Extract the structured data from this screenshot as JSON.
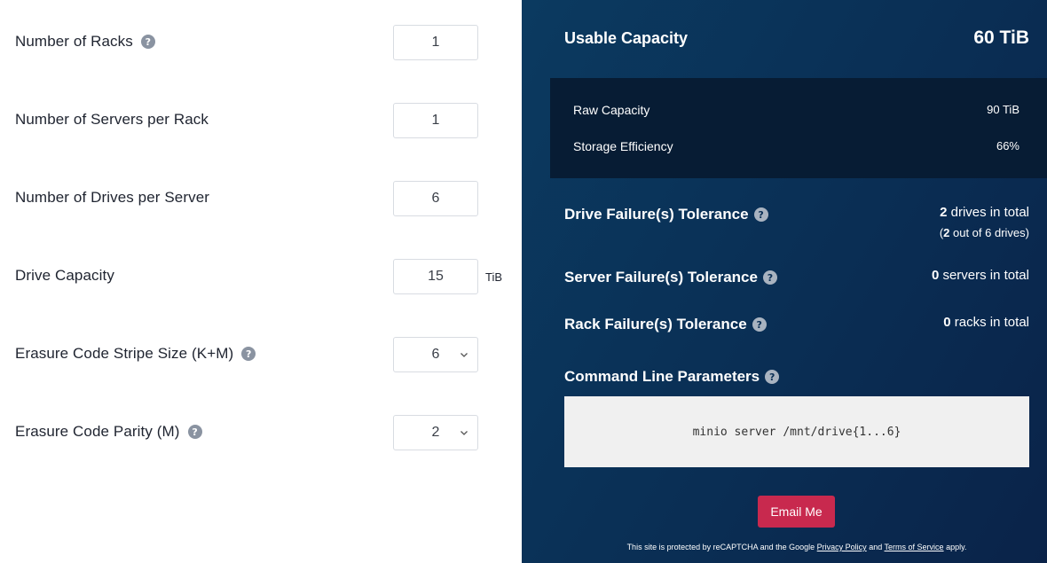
{
  "form": {
    "racks": {
      "label": "Number of Racks",
      "value": "1",
      "help_icon": "question-circle-icon"
    },
    "servers": {
      "label": "Number of Servers per Rack",
      "value": "1"
    },
    "drives": {
      "label": "Number of Drives per Server",
      "value": "6"
    },
    "capacity": {
      "label": "Drive Capacity",
      "value": "15",
      "unit": "TiB"
    },
    "stripe": {
      "label": "Erasure Code Stripe Size (K+M)",
      "value": "6",
      "help_icon": "question-circle-icon"
    },
    "parity": {
      "label": "Erasure Code Parity (M)",
      "value": "2",
      "help_icon": "question-circle-icon"
    }
  },
  "summary": {
    "usable_label": "Usable Capacity",
    "usable_value": "60 TiB",
    "raw_label": "Raw Capacity",
    "raw_value": "90 TiB",
    "efficiency_label": "Storage Efficiency",
    "efficiency_value": "66%",
    "drive_tol_label": "Drive Failure(s) Tolerance",
    "drive_tol_count": "2",
    "drive_tol_suffix": " drives in total",
    "drive_tol_sub_num": "2",
    "drive_tol_sub_rest": " out of 6 drives)",
    "drive_tol_sub_open": "(",
    "server_tol_label": "Server Failure(s) Tolerance",
    "server_tol_count": "0",
    "server_tol_suffix": " servers in total",
    "rack_tol_label": "Rack Failure(s) Tolerance",
    "rack_tol_count": "0",
    "rack_tol_suffix": " racks in total",
    "cmd_label": "Command Line Parameters",
    "cmd_value": "minio server /mnt/drive{1...6}",
    "email_button": "Email Me",
    "recaptcha_pre": "This site is protected by reCAPTCHA and the Google ",
    "privacy_link": "Privacy Policy",
    "recaptcha_and": " and ",
    "terms_link": "Terms of Service",
    "recaptcha_post": " apply."
  },
  "colors": {
    "panel_bg": "#0a2e54",
    "raw_box_bg": "#071c34",
    "email_button_bg": "#c8294e",
    "help_icon_bg": "#8a93a1"
  }
}
